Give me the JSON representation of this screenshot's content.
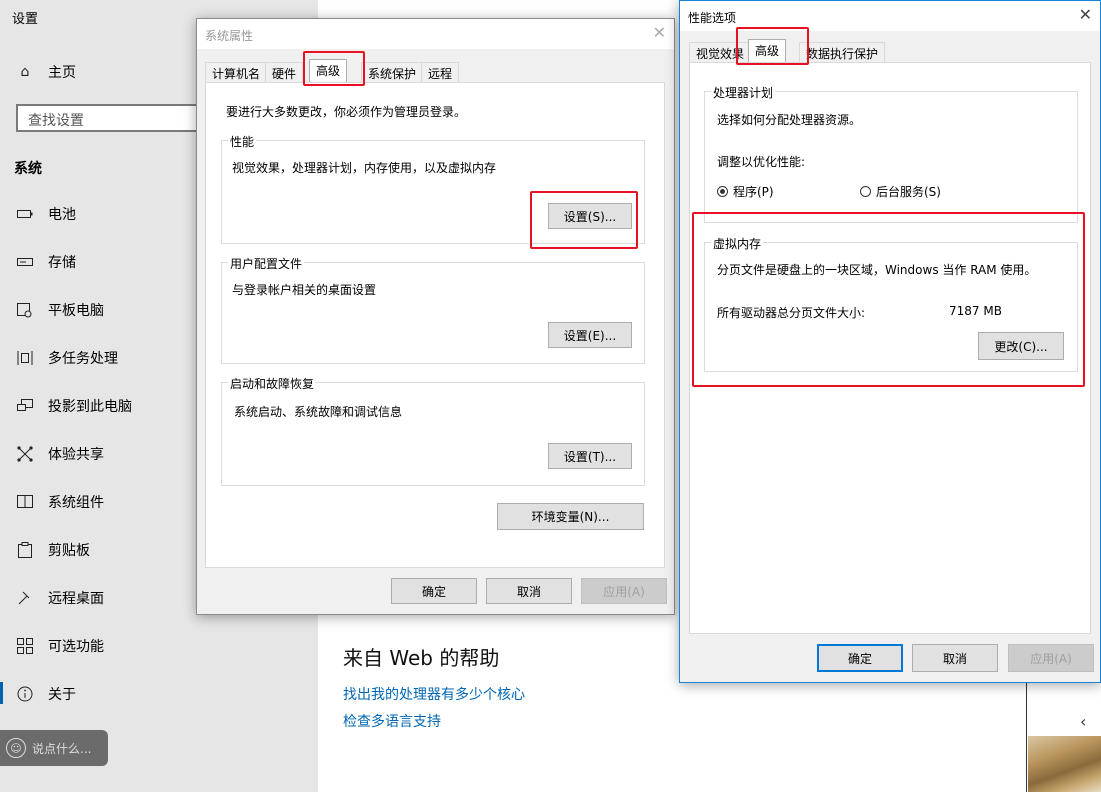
{
  "settings": {
    "title": "设置",
    "home": "主页",
    "search_placeholder": "查找设置",
    "section": "系统",
    "nav": [
      {
        "label": "电池",
        "icon": "battery-icon"
      },
      {
        "label": "存储",
        "icon": "storage-icon"
      },
      {
        "label": "平板电脑",
        "icon": "tablet-icon"
      },
      {
        "label": "多任务处理",
        "icon": "multitasking-icon"
      },
      {
        "label": "投影到此电脑",
        "icon": "projection-icon"
      },
      {
        "label": "体验共享",
        "icon": "shared-experiences-icon"
      },
      {
        "label": "系统组件",
        "icon": "system-components-icon"
      },
      {
        "label": "剪贴板",
        "icon": "clipboard-icon"
      },
      {
        "label": "远程桌面",
        "icon": "remote-desktop-icon"
      },
      {
        "label": "可选功能",
        "icon": "optional-features-icon"
      },
      {
        "label": "关于",
        "icon": "info-icon"
      }
    ],
    "chat_placeholder": "说点什么...",
    "web_help_title": "来自 Web 的帮助",
    "help_links": [
      "找出我的处理器有多少个核心",
      "检查多语言支持"
    ]
  },
  "sysprops": {
    "title": "系统属性",
    "tabs": [
      "计算机名",
      "硬件",
      "高级",
      "系统保护",
      "远程"
    ],
    "active_tab": "高级",
    "admin_note": "要进行大多数更改，你必须作为管理员登录。",
    "performance": {
      "label": "性能",
      "desc": "视觉效果，处理器计划，内存使用，以及虚拟内存",
      "button": "设置(S)..."
    },
    "profiles": {
      "label": "用户配置文件",
      "desc": "与登录帐户相关的桌面设置",
      "button": "设置(E)..."
    },
    "startup": {
      "label": "启动和故障恢复",
      "desc": "系统启动、系统故障和调试信息",
      "button": "设置(T)..."
    },
    "env_button": "环境变量(N)...",
    "ok": "确定",
    "cancel": "取消",
    "apply": "应用(A)"
  },
  "perf": {
    "title": "性能选项",
    "tabs": [
      "视觉效果",
      "高级",
      "数据执行保护"
    ],
    "active_tab": "高级",
    "scheduling": {
      "label": "处理器计划",
      "desc": "选择如何分配处理器资源。",
      "adjust": "调整以优化性能:",
      "programs": "程序(P)",
      "background": "后台服务(S)",
      "selected": "程序(P)"
    },
    "vm": {
      "label": "虚拟内存",
      "desc": "分页文件是硬盘上的一块区域，Windows 当作 RAM 使用。",
      "total_label": "所有驱动器总分页文件大小:",
      "total_value": "7187 MB",
      "change": "更改(C)..."
    },
    "ok": "确定",
    "cancel": "取消",
    "apply": "应用(A)"
  },
  "colors": {
    "highlight": "#e81123",
    "accent": "#0078d7",
    "link": "#0066b4"
  }
}
